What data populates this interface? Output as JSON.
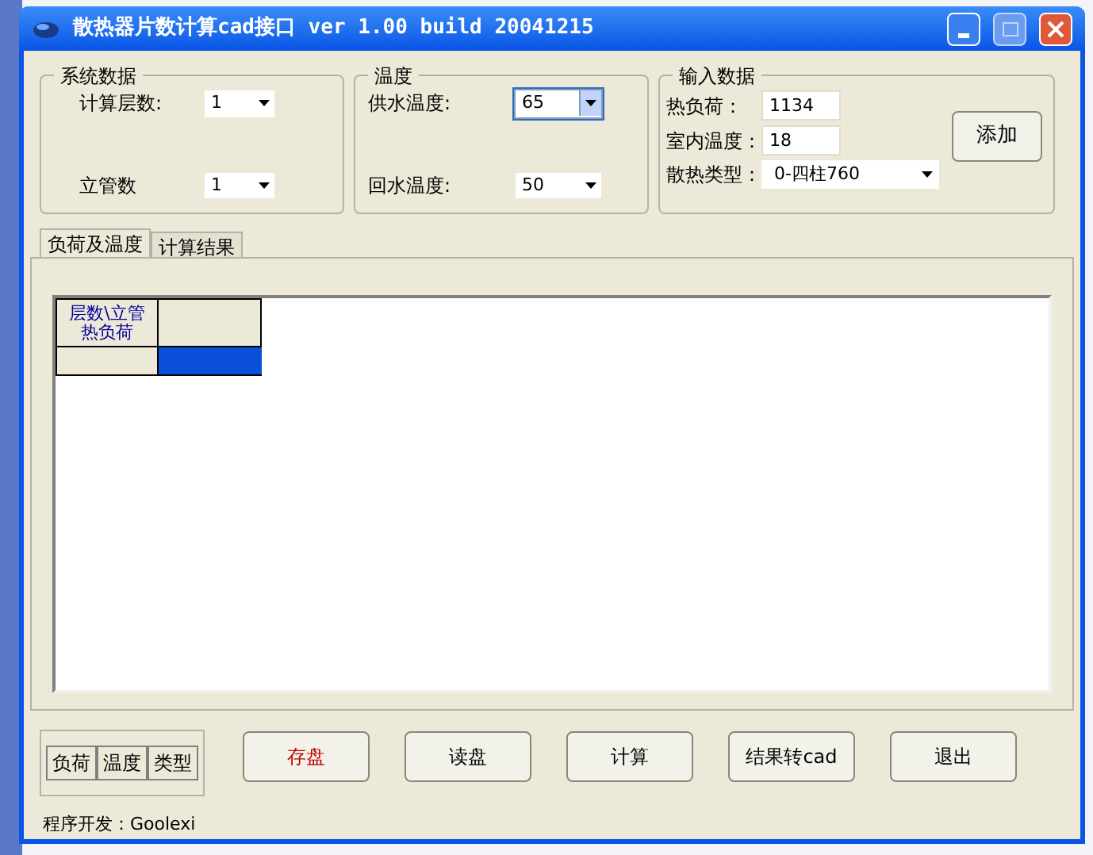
{
  "window": {
    "title": "散热器片数计算cad接口 ver 1.00 build 20041215"
  },
  "groups": [
    {
      "title": "系统数据",
      "fields": [
        {
          "label": "计算层数:",
          "value": "1",
          "focused": false
        },
        {
          "label": "立管数",
          "value": "1",
          "focused": false
        }
      ]
    },
    {
      "title": "温度",
      "fields": [
        {
          "label": "供水温度:",
          "value": "65",
          "focused": true
        },
        {
          "label": "回水温度:",
          "value": "50",
          "focused": false
        }
      ]
    }
  ],
  "input_group": {
    "title": "输入数据",
    "heat_load": {
      "label": "热负荷：",
      "value": "1134"
    },
    "room_temp": {
      "label": "室内温度：",
      "value": "18"
    },
    "radiator_type": {
      "label": "散热类型：",
      "value": "0-四柱760"
    },
    "add_button": "添加"
  },
  "tabs": [
    {
      "label": "负荷及温度",
      "selected": true
    },
    {
      "label": "计算结果",
      "selected": false
    }
  ],
  "grid": {
    "header": [
      "层数\\立管",
      "热负荷"
    ],
    "selected_cell": true
  },
  "toggle_buttons": [
    "负荷",
    "温度",
    "类型"
  ],
  "buttons": [
    {
      "label": "存盘",
      "kind": "primary"
    },
    {
      "label": "读盘",
      "kind": "normal"
    },
    {
      "label": "计算",
      "kind": "normal"
    },
    {
      "label": "结果转cad",
      "kind": "normal"
    },
    {
      "label": "退出",
      "kind": "normal"
    }
  ],
  "status": "程序开发：Goolexi"
}
